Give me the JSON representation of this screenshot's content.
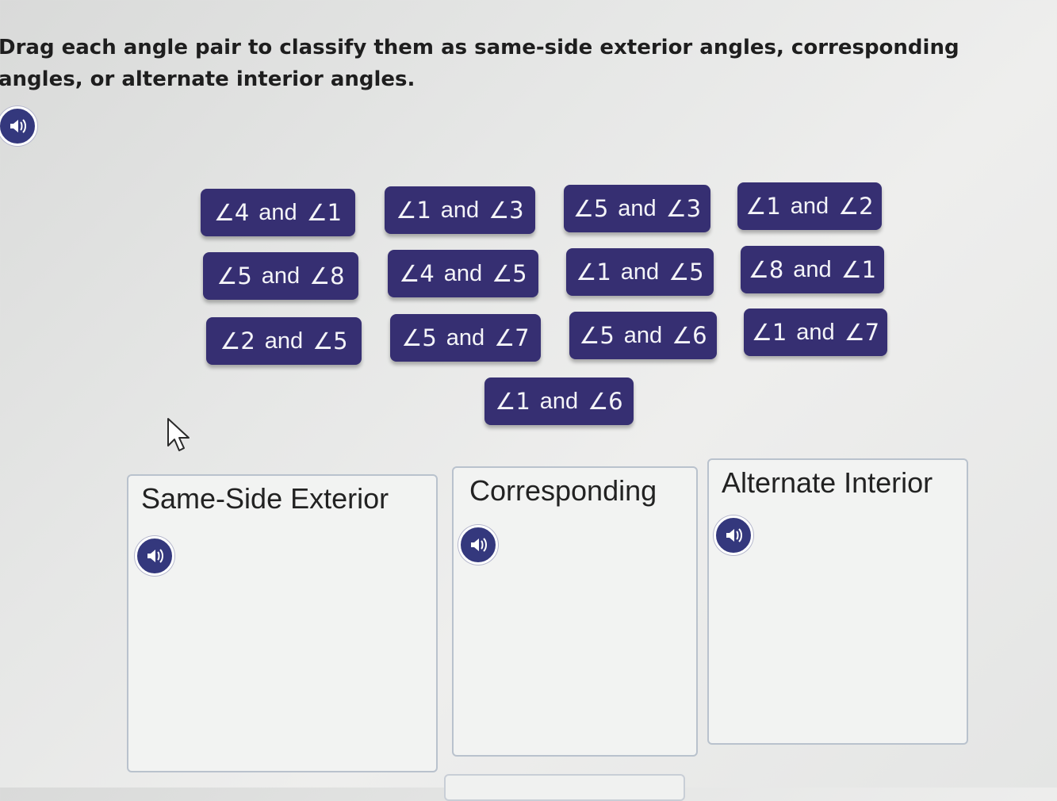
{
  "instructions": "Drag each angle pair to classify them as same-side exterior angles, corresponding angles, or alternate interior angles.",
  "icons": {
    "audio": "speaker-icon",
    "cursor": "mouse-pointer-icon"
  },
  "colors": {
    "tile_bg": "#362f72",
    "tile_text": "#f4f4f8",
    "audio_bg": "#34387d",
    "bin_border": "#b9c2cd"
  },
  "tiles": [
    {
      "a": "∠4",
      "join": "and",
      "b": "∠1"
    },
    {
      "a": "∠1",
      "join": "and",
      "b": "∠3"
    },
    {
      "a": "∠5",
      "join": "and",
      "b": "∠3"
    },
    {
      "a": "∠1",
      "join": "and",
      "b": "∠2"
    },
    {
      "a": "∠5",
      "join": "and",
      "b": "∠8"
    },
    {
      "a": "∠4",
      "join": "and",
      "b": "∠5"
    },
    {
      "a": "∠1",
      "join": "and",
      "b": "∠5"
    },
    {
      "a": "∠8",
      "join": "and",
      "b": "∠1"
    },
    {
      "a": "∠2",
      "join": "and",
      "b": "∠5"
    },
    {
      "a": "∠5",
      "join": "and",
      "b": "∠7"
    },
    {
      "a": "∠5",
      "join": "and",
      "b": "∠6"
    },
    {
      "a": "∠1",
      "join": "and",
      "b": "∠7"
    },
    {
      "a": "∠1",
      "join": "and",
      "b": "∠6"
    }
  ],
  "bins": [
    {
      "title": "Same-Side Exterior"
    },
    {
      "title": "Corresponding"
    },
    {
      "title": "Alternate Interior"
    }
  ]
}
